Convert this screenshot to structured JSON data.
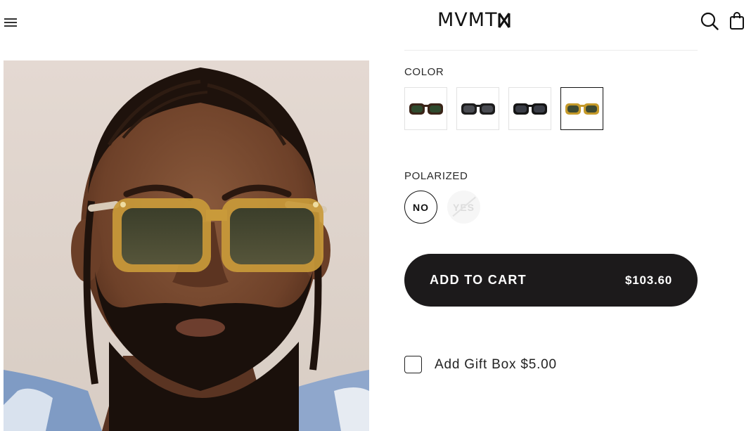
{
  "header": {
    "brand": "MVMT",
    "menu_icon": "hamburger-menu-icon",
    "search_icon": "search-icon",
    "cart_icon": "shopping-bag-icon"
  },
  "product": {
    "image_alt_icon": "model-wearing-sunglasses-photo"
  },
  "color": {
    "label": "COLOR",
    "swatches": [
      {
        "name": "tortoise-green",
        "frame": "#3a2418",
        "lens": "#2f4a2e",
        "selected": false
      },
      {
        "name": "black-grey",
        "frame": "#1c1c1c",
        "lens": "#4a4c52",
        "selected": false
      },
      {
        "name": "black-dark-grey",
        "frame": "#151515",
        "lens": "#3a3d46",
        "selected": false
      },
      {
        "name": "honey-green",
        "frame": "#c59a2a",
        "lens": "#3d4a33",
        "selected": true
      }
    ]
  },
  "polarized": {
    "label": "POLARIZED",
    "options": [
      {
        "label": "NO",
        "selected": true,
        "disabled": false
      },
      {
        "label": "YES",
        "selected": false,
        "disabled": true
      }
    ]
  },
  "cart": {
    "button_label": "ADD TO CART",
    "price": "$103.60"
  },
  "gift": {
    "label": "Add Gift Box $5.00",
    "checked": false
  },
  "colors": {
    "button_bg": "#1c1a1b",
    "text": "#1d1b1c"
  }
}
